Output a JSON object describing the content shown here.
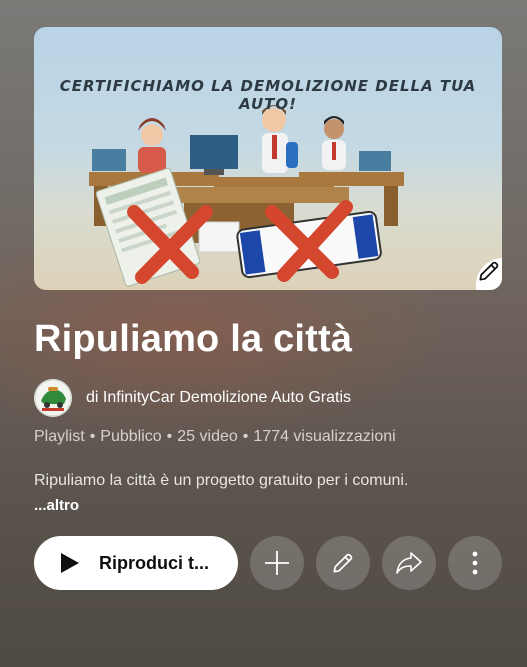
{
  "thumbnail": {
    "caption": "CERTIFICHIAMO LA DEMOLIZIONE DELLA TUA AUTO!",
    "edit_icon": "pencil-icon"
  },
  "playlist": {
    "title": "Ripuliamo la città",
    "owner_prefix": "di",
    "owner": "InfinityCar Demolizione Auto Gratis",
    "type": "Playlist",
    "privacy": "Pubblico",
    "video_count": "25 video",
    "views": "1774 visualizzazioni",
    "description": "Ripuliamo la città è un progetto gratuito per i comuni.",
    "more_label": "...altro"
  },
  "actions": {
    "play_label": "Riproduci t...",
    "play_icon": "play-icon",
    "add_icon": "plus-icon",
    "edit_icon": "pencil-icon",
    "share_icon": "share-icon",
    "more_icon": "more-vertical-icon"
  },
  "colors": {
    "button_bg": "#ffffff",
    "text": "#ffffff"
  }
}
